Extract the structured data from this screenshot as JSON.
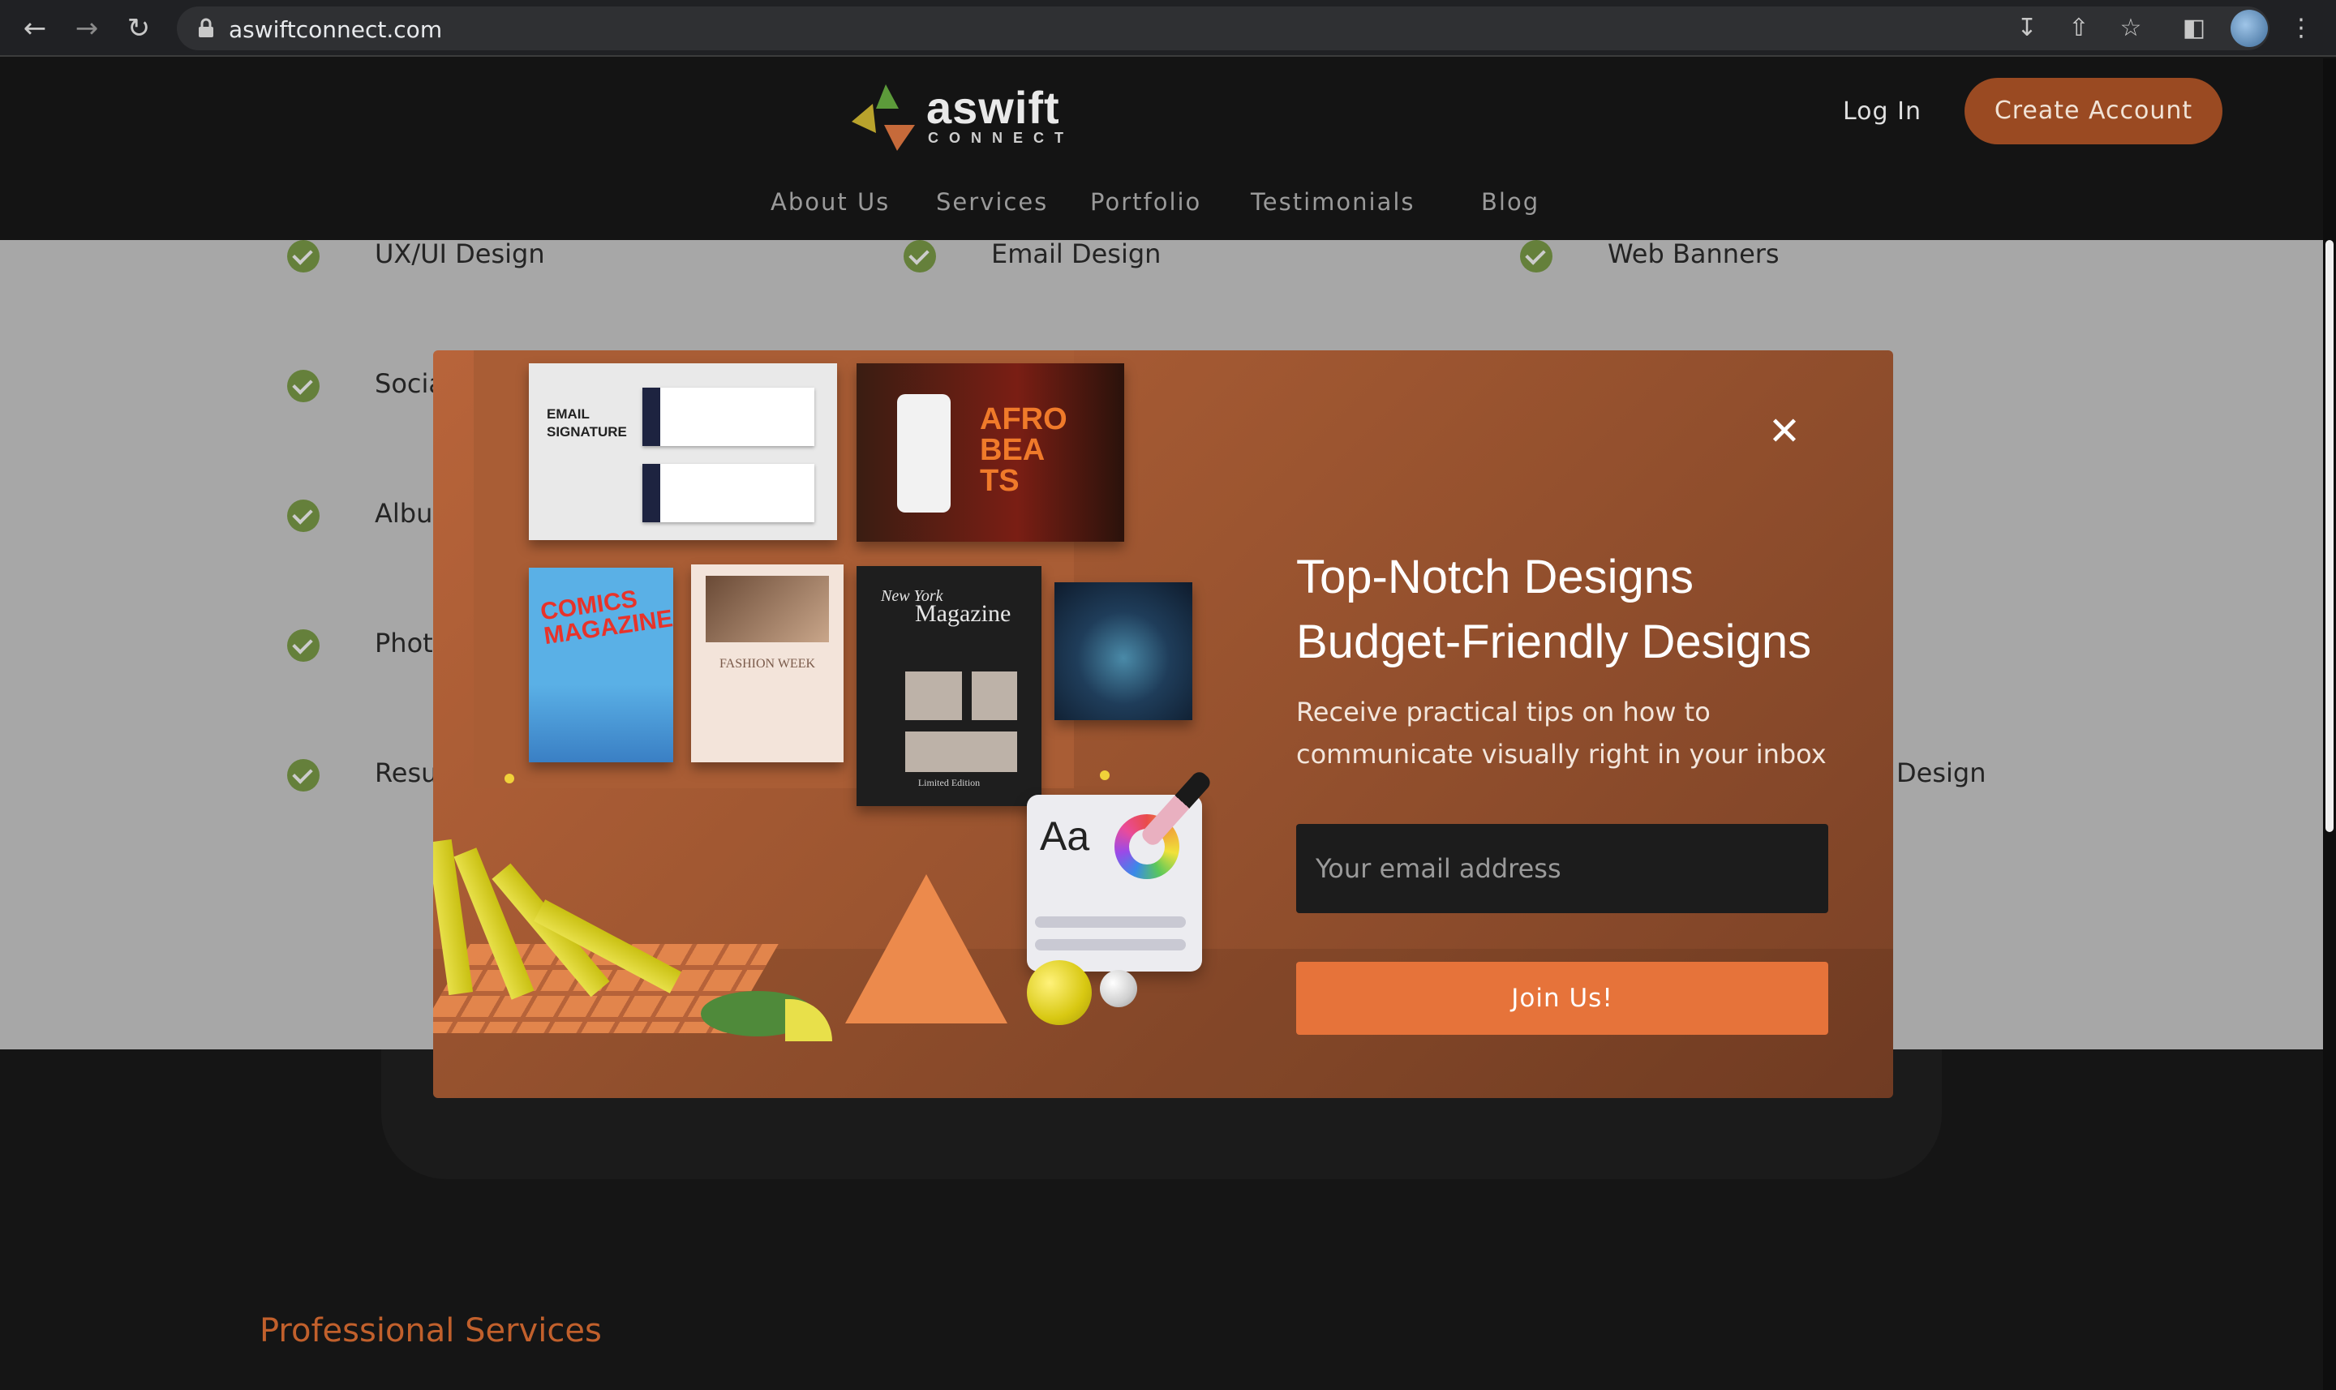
{
  "browser": {
    "url": "aswiftconnect.com",
    "icons": [
      "back-arrow-icon",
      "forward-arrow-icon",
      "reload-icon",
      "lock-icon",
      "install-icon",
      "share-icon",
      "bookmark-star-icon",
      "side-panel-icon",
      "profile-avatar",
      "more-menu-icon"
    ]
  },
  "header": {
    "logo_word": "aswift",
    "logo_sub": "CONNECT",
    "login_label": "Log In",
    "create_label": "Create Account",
    "nav": [
      "About Us",
      "Services",
      "Portfolio",
      "Testimonials",
      "Blog"
    ]
  },
  "services": {
    "row1": [
      "UX/UI Design",
      "Email Design",
      "Web Banners"
    ],
    "left_partial": [
      "Socia",
      "Albu",
      "Phot",
      "Resu"
    ],
    "right_partial": "Design"
  },
  "footer": {
    "section_title": "Professional Services"
  },
  "modal": {
    "headline_1": "Top-Notch Designs",
    "headline_2": "Budget-Friendly Designs",
    "description": "Receive practical tips on how to communicate visually right in your inbox",
    "email_placeholder": "Your email address",
    "join_label": "Join Us!",
    "close_icon": "close-icon",
    "illustration": {
      "email_card_title": "EMAIL SIGNATURE",
      "afro_title": "AFRO BEA TS",
      "comic_title": "COMICS MAGAZINE",
      "fashion_title": "FASHION WEEK",
      "mag_title_1": "New York",
      "mag_title_2": "Magazine",
      "mag_footer": "Limited Edition",
      "type_card": "Aa"
    }
  },
  "colors": {
    "accent": "#e6733a",
    "create_button": "#9a4a22",
    "check_green": "#7fa14a",
    "section_title": "#c1602c"
  }
}
